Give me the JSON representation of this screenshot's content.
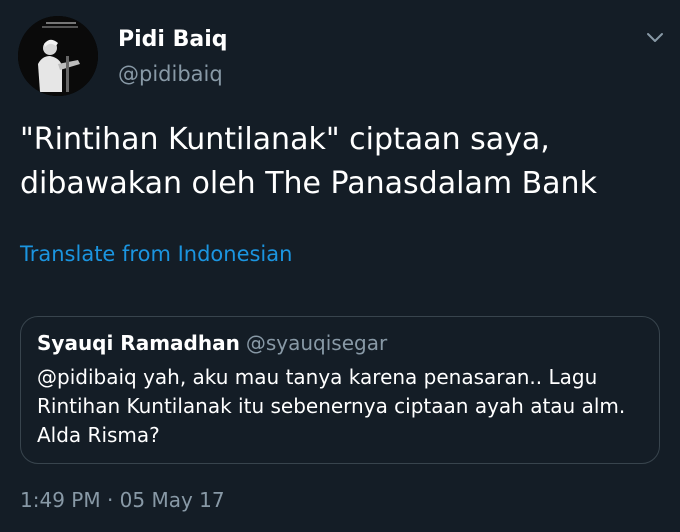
{
  "author": {
    "display_name": "Pidi Baiq",
    "handle": "@pidibaiq"
  },
  "tweet": {
    "text": "\"Rintihan Kuntilanak\" ciptaan saya, dibawakan oleh The Panasdalam Bank",
    "translate_label": "Translate from Indonesian",
    "timestamp": "1:49 PM · 05 May 17"
  },
  "quoted_tweet": {
    "display_name": "Syauqi Ramadhan",
    "handle": "@syauqisegar",
    "text": "@pidibaiq yah, aku mau tanya karena penasaran.. Lagu Rintihan Kuntilanak itu sebenernya ciptaan ayah atau alm. Alda Risma?"
  },
  "icons": {
    "menu": "chevron-down-icon"
  },
  "colors": {
    "background": "#141d26",
    "text_primary": "#ffffff",
    "text_secondary": "#8899a6",
    "link": "#1b95e0",
    "border": "#38444d"
  }
}
